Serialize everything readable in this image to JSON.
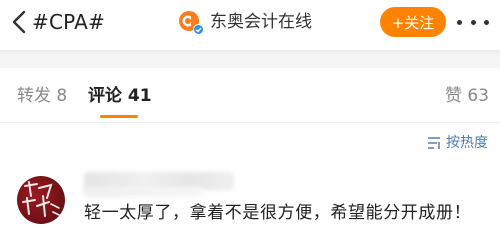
{
  "header": {
    "hashtag": "#CPA#",
    "brand_name": "东奥会计在线",
    "follow_label": "+关注",
    "icons": [
      "chevron-left-icon",
      "brand-logo-icon",
      "verified-badge-icon",
      "more-dots-icon"
    ]
  },
  "tabs": {
    "repost": "转发 8",
    "comment": "评论 41",
    "like": "赞 63"
  },
  "sort": {
    "label": "按热度",
    "icon": "sort-lines-icon"
  },
  "comment": {
    "text": "轻一太厚了，拿着不是很方便，希望能分开成册！"
  },
  "colors": {
    "accent": "#ff8200",
    "link": "#507daf",
    "muted": "#8a8a8a"
  }
}
